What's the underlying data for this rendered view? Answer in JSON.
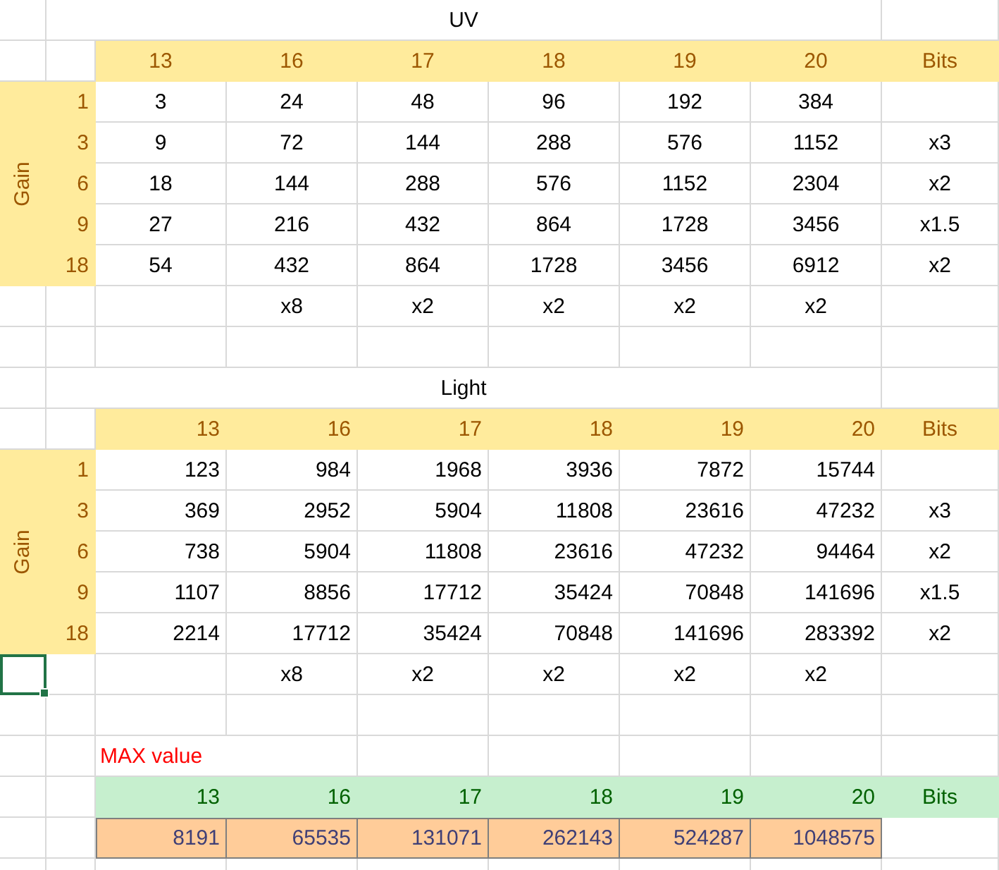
{
  "tables": [
    {
      "title": "UV",
      "kind": "centered",
      "columns": [
        "13",
        "16",
        "17",
        "18",
        "19",
        "20"
      ],
      "bits_header": "Bits",
      "gain_label": "Gain",
      "rows": [
        {
          "gain": "1",
          "values": [
            "3",
            "24",
            "48",
            "96",
            "192",
            "384"
          ]
        },
        {
          "gain": "3",
          "values": [
            "9",
            "72",
            "144",
            "288",
            "576",
            "1152"
          ],
          "bits": "x3"
        },
        {
          "gain": "6",
          "values": [
            "18",
            "144",
            "288",
            "576",
            "1152",
            "2304"
          ],
          "bits": "x2"
        },
        {
          "gain": "9",
          "values": [
            "27",
            "216",
            "432",
            "864",
            "1728",
            "3456"
          ],
          "bits": "x1.5"
        },
        {
          "gain": "18",
          "values": [
            "54",
            "432",
            "864",
            "1728",
            "3456",
            "6912"
          ],
          "bits": "x2"
        }
      ],
      "multipliers": [
        "x8",
        "x2",
        "x2",
        "x2",
        "x2"
      ],
      "first_cell_selected": false
    },
    {
      "title": "Light",
      "kind": "right",
      "columns": [
        "13",
        "16",
        "17",
        "18",
        "19",
        "20"
      ],
      "bits_header": "Bits",
      "gain_label": "Gain",
      "rows": [
        {
          "gain": "1",
          "values": [
            "123",
            "984",
            "1968",
            "3936",
            "7872",
            "15744"
          ]
        },
        {
          "gain": "3",
          "values": [
            "369",
            "2952",
            "5904",
            "11808",
            "23616",
            "47232"
          ],
          "bits": "x3"
        },
        {
          "gain": "6",
          "values": [
            "738",
            "5904",
            "11808",
            "23616",
            "47232",
            "94464"
          ],
          "bits": "x2"
        },
        {
          "gain": "9",
          "values": [
            "1107",
            "8856",
            "17712",
            "35424",
            "70848",
            "141696"
          ],
          "bits": "x1.5"
        },
        {
          "gain": "18",
          "values": [
            "2214",
            "17712",
            "35424",
            "70848",
            "141696",
            "283392"
          ],
          "bits": "x2"
        }
      ],
      "multipliers": [
        "x8",
        "x2",
        "x2",
        "x2",
        "x2"
      ],
      "first_cell_selected": true
    }
  ],
  "max_table": {
    "label": "MAX value",
    "columns": [
      "13",
      "16",
      "17",
      "18",
      "19",
      "20"
    ],
    "bits_header": "Bits",
    "values": [
      "8191",
      "65535",
      "131071",
      "262143",
      "524287",
      "1048575"
    ]
  }
}
